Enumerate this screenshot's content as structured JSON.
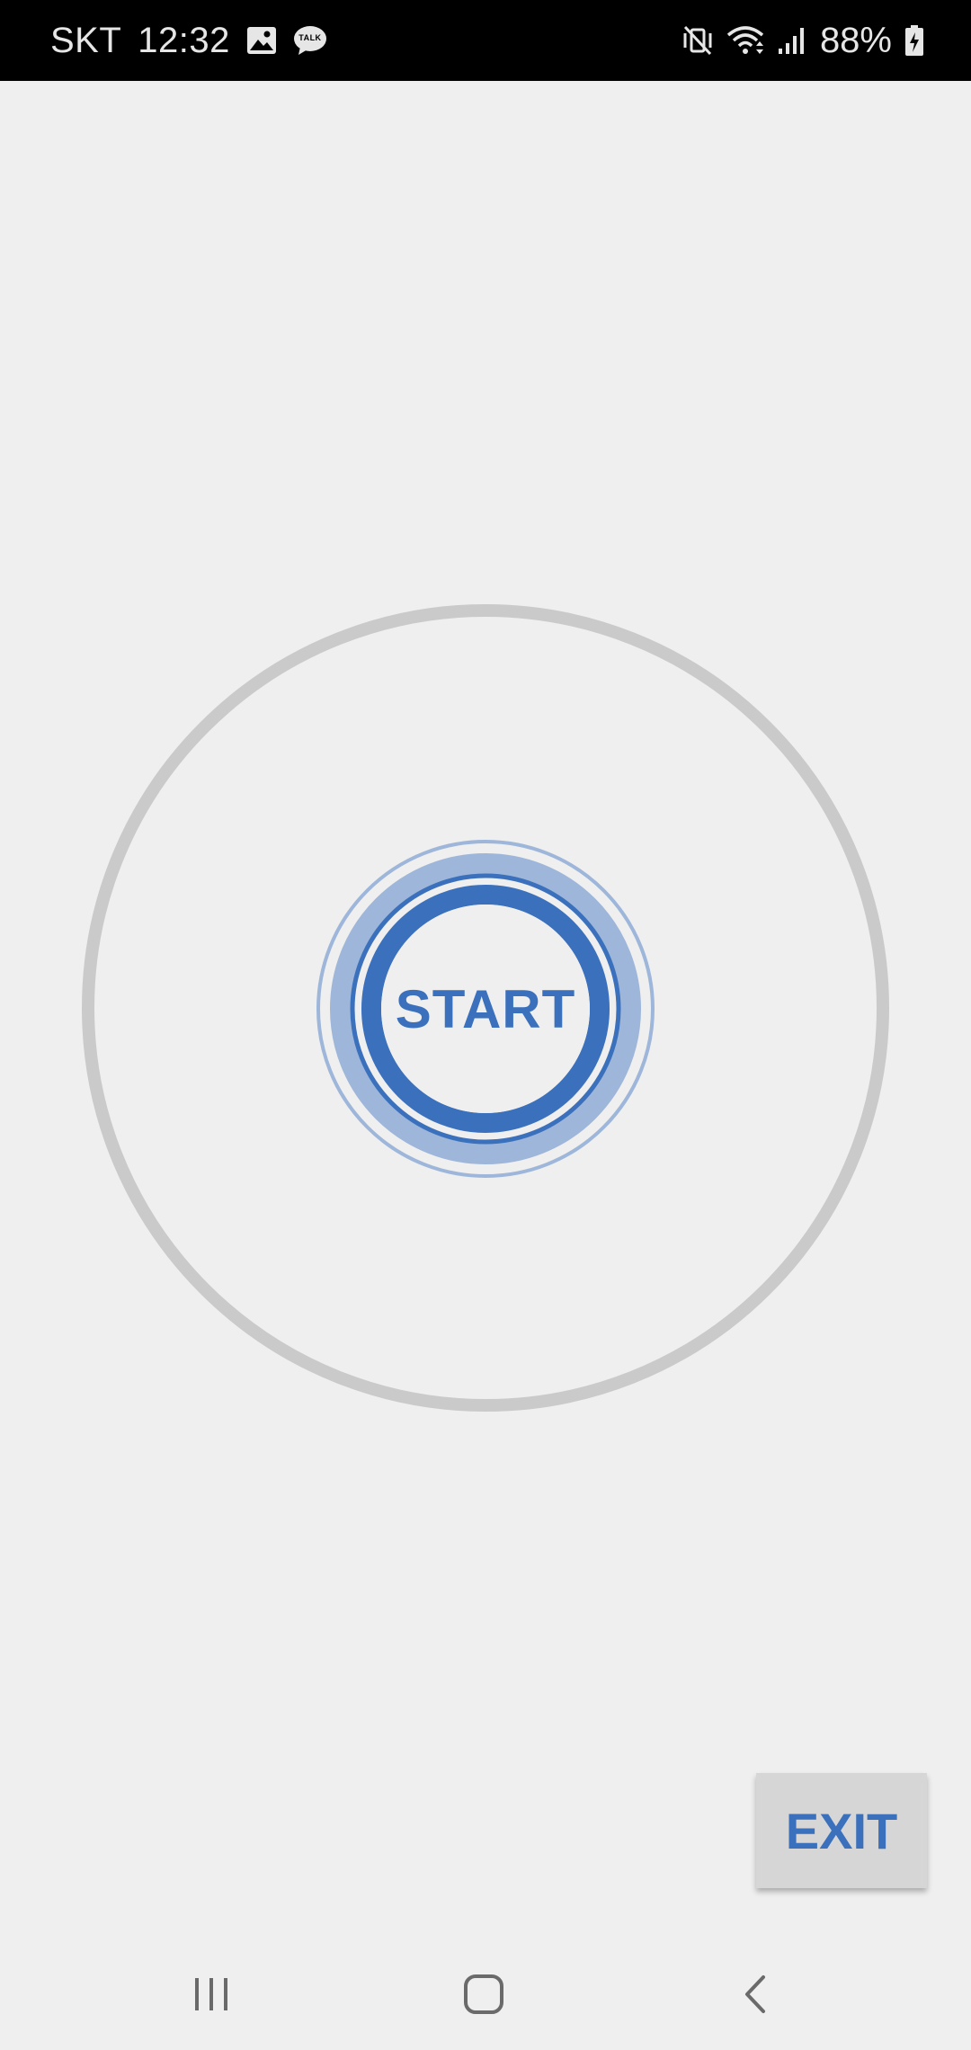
{
  "status_bar": {
    "carrier": "SKT",
    "time": "12:32",
    "battery_percent": "88%",
    "left_icons": [
      "image-icon",
      "kakaotalk-icon"
    ],
    "right_icons": [
      "vibrate-mute-icon",
      "wifi-icon",
      "signal-icon",
      "battery-charging-icon"
    ]
  },
  "kakaotalk_badge": "TALK",
  "main": {
    "start_label": "START",
    "exit_label": "EXIT"
  },
  "colors": {
    "accent": "#3b71bc",
    "accent_light": "#9db6da",
    "ring": "#cacaca",
    "background": "#efefef",
    "exit_background": "#d6d6d6"
  },
  "nav_bar": {
    "items": [
      {
        "name": "recent-apps",
        "icon": "recent-apps-icon"
      },
      {
        "name": "home",
        "icon": "home-icon"
      },
      {
        "name": "back",
        "icon": "back-icon"
      }
    ]
  }
}
